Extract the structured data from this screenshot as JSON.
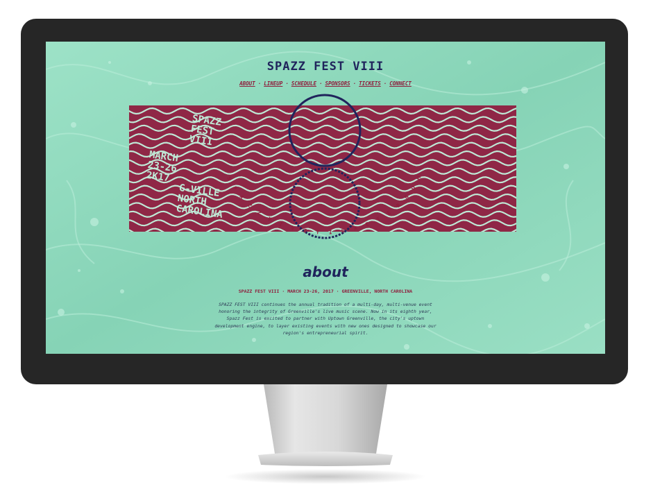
{
  "site": {
    "title": "SPAZZ FEST VIII",
    "nav": [
      "ABOUT",
      "LINEUP",
      "SCHEDULE",
      "SPONSORS",
      "TICKETS",
      "CONNECT"
    ],
    "nav_separator": "·"
  },
  "poster": {
    "name_lines": [
      "SPAZZ",
      "FEST",
      "VIII"
    ],
    "date_lines": [
      "MARCH",
      "23-26",
      "2K17"
    ],
    "place_lines": [
      "G-VILLE",
      "NORTH",
      "CAROLINA"
    ],
    "motto_letters": [
      "S",
      "P",
      "A",
      "Z",
      "Z",
      "V",
      "I",
      "V",
      "E",
      "T",
      "I",
      "N",
      "A",
      "E",
      "T",
      "E",
      "R",
      "N",
      "U",
      "M"
    ]
  },
  "about": {
    "heading": "about",
    "event_info": "SPAZZ FEST VIII · MARCH 23-26, 2017 · GREENVILLE, NORTH CAROLINA",
    "body_lines": [
      "SPAZZ FEST VIII continues the annual tradition of a multi-day, multi-venue event",
      "honoring the integrity of Greenville's live music scene. Now in its eighth year,",
      "Spazz Fest is excited to partner with Uptown Greenville, the city's uptown",
      "development engine, to layer existing events with new ones designed to showcase our",
      "region's entrepreneurial spirit."
    ]
  },
  "colors": {
    "mint_background": "#8fd9bd",
    "navy": "#20245c",
    "maroon": "#8f1c3b",
    "banner": "#8f2746",
    "bezel": "#262626"
  }
}
